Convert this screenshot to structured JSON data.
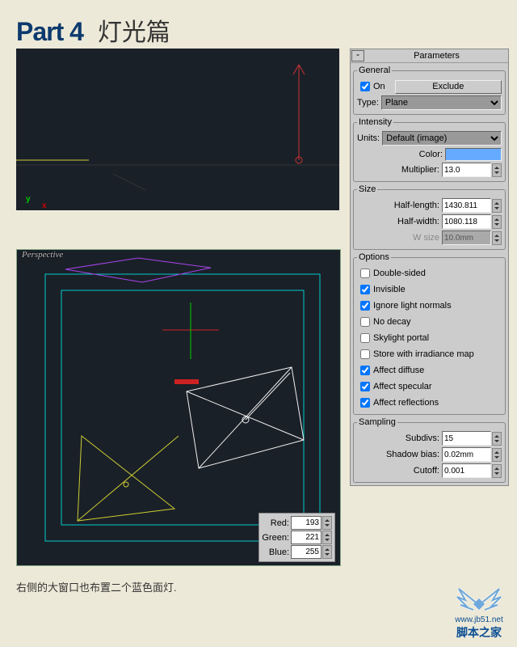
{
  "title": {
    "part": "Part 4",
    "sub": "灯光篇"
  },
  "viewports": {
    "perspective_label": "Perspective",
    "axis": {
      "x": "x",
      "y": "y"
    }
  },
  "rgb": {
    "red": {
      "label": "Red:",
      "value": "193"
    },
    "green": {
      "label": "Green:",
      "value": "221"
    },
    "blue": {
      "label": "Blue:",
      "value": "255"
    }
  },
  "caption": "右侧的大窗口也布置二个蓝色面灯.",
  "watermark": {
    "url": "www.jb51.net",
    "cn": "脚本之家"
  },
  "panel": {
    "header": "Parameters",
    "minus": "-",
    "general": {
      "legend": "General",
      "on": "On",
      "exclude": "Exclude",
      "type_label": "Type:",
      "type_value": "Plane"
    },
    "intensity": {
      "legend": "Intensity",
      "units_label": "Units:",
      "units_value": "Default (image)",
      "color_label": "Color:",
      "multiplier_label": "Multiplier:",
      "multiplier_value": "13.0"
    },
    "size": {
      "legend": "Size",
      "hl_label": "Half-length:",
      "hl_value": "1430.811",
      "hw_label": "Half-width:",
      "hw_value": "1080.118",
      "ws_label": "W size",
      "ws_value": "10.0mm"
    },
    "options": {
      "legend": "Options",
      "items": [
        {
          "label": "Double-sided",
          "checked": false
        },
        {
          "label": "Invisible",
          "checked": true
        },
        {
          "label": "Ignore light normals",
          "checked": true
        },
        {
          "label": "No decay",
          "checked": false
        },
        {
          "label": "Skylight portal",
          "checked": false
        },
        {
          "label": "Store with irradiance map",
          "checked": false
        },
        {
          "label": "Affect diffuse",
          "checked": true
        },
        {
          "label": "Affect specular",
          "checked": true
        },
        {
          "label": "Affect reflections",
          "checked": true
        }
      ]
    },
    "sampling": {
      "legend": "Sampling",
      "subdivs_label": "Subdivs:",
      "subdivs_value": "15",
      "sb_label": "Shadow bias:",
      "sb_value": "0.02mm",
      "cutoff_label": "Cutoff:",
      "cutoff_value": "0.001"
    }
  }
}
